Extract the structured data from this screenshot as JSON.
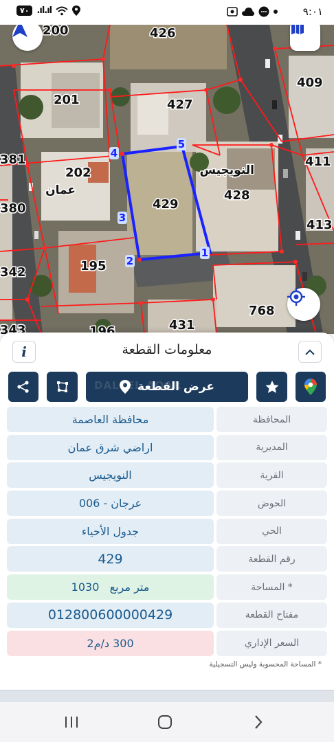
{
  "status_bar": {
    "time": "٩:٠١",
    "battery": "٧٠"
  },
  "map": {
    "selected_plot": "429",
    "vertices": [
      "1",
      "2",
      "3",
      "4",
      "5"
    ],
    "plot_labels": [
      {
        "id": "200",
        "text": "200"
      },
      {
        "id": "426",
        "text": "426"
      },
      {
        "id": "409",
        "text": "409"
      },
      {
        "id": "201",
        "text": "201"
      },
      {
        "id": "427",
        "text": "427"
      },
      {
        "id": "381",
        "text": "381"
      },
      {
        "id": "202",
        "text": "202"
      },
      {
        "id": "411",
        "text": "411"
      },
      {
        "id": "380",
        "text": "380"
      },
      {
        "id": "429",
        "text": "429"
      },
      {
        "id": "428",
        "text": "428"
      },
      {
        "id": "413",
        "text": "413"
      },
      {
        "id": "342",
        "text": "342"
      },
      {
        "id": "195",
        "text": "195"
      },
      {
        "id": "768",
        "text": "768"
      },
      {
        "id": "343",
        "text": "343"
      },
      {
        "id": "431",
        "text": "431"
      },
      {
        "id": "196",
        "text": "196"
      }
    ],
    "place_names": {
      "nuwayjees": "النويجيس",
      "amman": "عمان"
    },
    "colors": {
      "plot_outline": "#ff1a1a",
      "selection_outline": "#1a22ff",
      "vertex_label": "#1a22ff"
    }
  },
  "panel": {
    "title": "معلومات القطعة",
    "info_label": "i",
    "show_plot_label": "عرض القطعة",
    "watermark": "DALEEL AQAR",
    "rows": [
      {
        "label": "المحافظة",
        "value": "محافظة العاصمة",
        "tone": "default"
      },
      {
        "label": "المديرية",
        "value": "اراضي شرق عمان",
        "tone": "default"
      },
      {
        "label": "القرية",
        "value": "النويجيس",
        "tone": "default"
      },
      {
        "label": "الحوض",
        "value": "عرجان - 006",
        "tone": "default"
      },
      {
        "label": "الحي",
        "value": "جدول الأحياء",
        "tone": "default"
      },
      {
        "label": "رقم القطعة",
        "value": "429",
        "tone": "default"
      },
      {
        "label": "المساحة *",
        "value": "1030   متر مربع",
        "tone": "green"
      },
      {
        "label": "مفتاح القطعة",
        "value": "012800600000429",
        "tone": "default"
      },
      {
        "label": "السعر الإداري",
        "value": "300 د/م2",
        "tone": "pink"
      }
    ],
    "footnote": "* المساحة المحسوبة وليس التسجيلية",
    "colors": {
      "primary": "#1b3a5c",
      "value_text": "#1a5a8e"
    }
  },
  "navbar": {
    "recents_icon": "recent-apps-icon",
    "home_icon": "home-icon",
    "back_icon": "back-icon"
  }
}
